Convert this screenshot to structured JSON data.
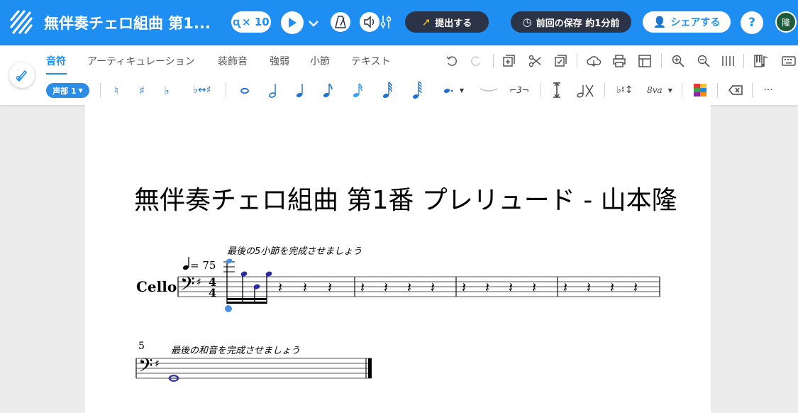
{
  "header": {
    "title": "無伴奏チェロ組曲 第1...",
    "speed_label": "× 10",
    "submit_label": "提出する",
    "saved_label": "前回の保存 約1分前",
    "share_label": "シェアする",
    "help_label": "?",
    "avatar_initial": "隆"
  },
  "toolbar": {
    "tabs": [
      "音符",
      "アーティキュレーション",
      "装飾音",
      "強弱",
      "小節",
      "テキスト"
    ],
    "active_tab": "音符",
    "voice_label": "声部 1",
    "tuplet_label": "3",
    "octave_label": "8va"
  },
  "score": {
    "title": "無伴奏チェロ組曲 第1番 プレリュード - 山本隆",
    "instrument": "Cello",
    "tempo": "= 75",
    "instruction_1": "最後の5小節を完成させましょう",
    "instruction_2": "最後の和音を完成させましょう",
    "measure_number": "5"
  },
  "colors": {
    "brand_blue": "#1e8ef3",
    "dark_button": "#2b3346",
    "selection_blue": "#4a90e2",
    "avatar_green": "#1e5a3a"
  }
}
